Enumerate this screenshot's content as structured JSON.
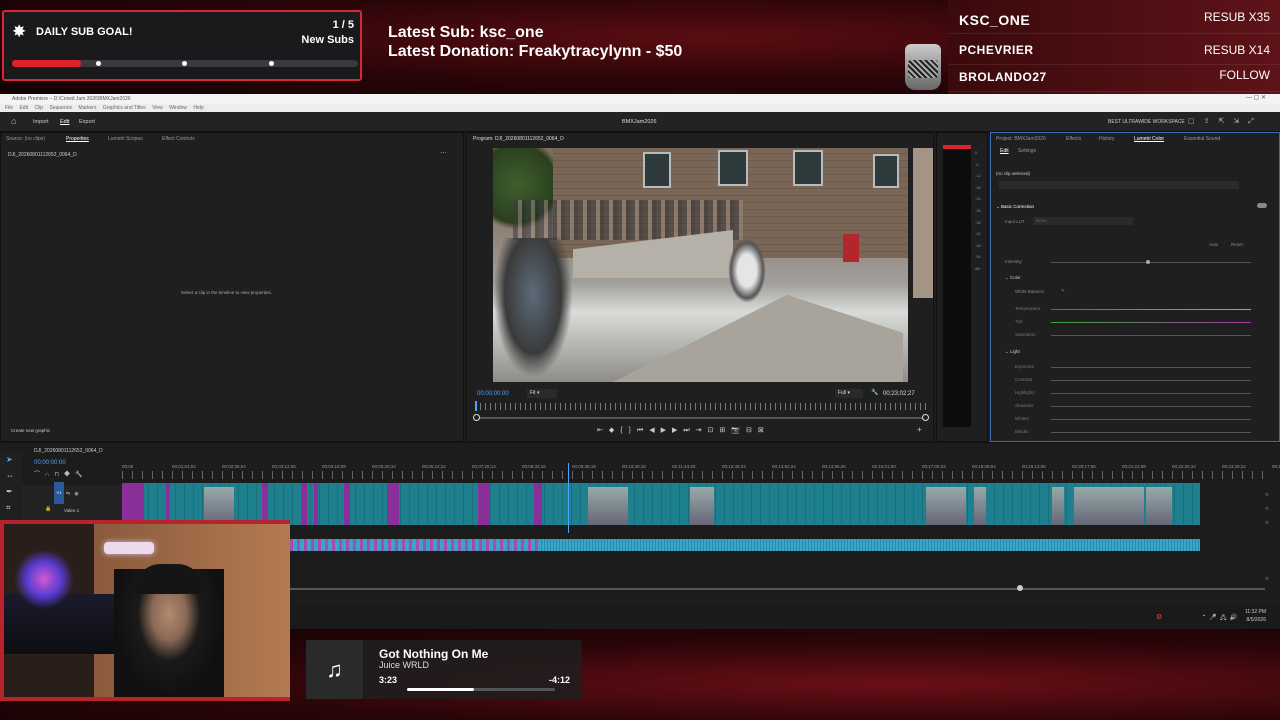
{
  "sub_goal": {
    "title": "DAILY SUB GOAL!",
    "count": "1 / 5",
    "unit": "New Subs",
    "progress": 0.2
  },
  "latest": {
    "sub": "Latest Sub: ksc_one",
    "donation": "Latest Donation: Freakytracylynn  - $50"
  },
  "subscribers": [
    {
      "name": "KSC_ONE",
      "tag": "RESUB X35"
    },
    {
      "name": "PCHEVRIER",
      "tag": "RESUB X14"
    },
    {
      "name": "BROLANDO27",
      "tag": "FOLLOW"
    }
  ],
  "premiere": {
    "window_title": "Adobe Premiere – D:\\Crowd Jam 2026\\BMXJam2026",
    "menu": [
      "File",
      "Edit",
      "Clip",
      "Sequence",
      "Markers",
      "Graphics and Titles",
      "View",
      "Window",
      "Help"
    ],
    "toolbar": {
      "import": "Import",
      "edit": "Edit",
      "export": "Export",
      "project": "BMXJam2026",
      "workspace": "BEST ULTRAWIDE WORKSPACE"
    },
    "source_tabs": [
      "Source: (no clips)",
      "Properties",
      "Lumetri Scopes",
      "Effect Controls"
    ],
    "source_clip": "DJI_20260801112652_0064_D",
    "source_empty": "Select a clip in the timeline to view properties.",
    "source_create": "Create new graphic",
    "program_title": "Program: DJI_20260801112652_0064_D",
    "program_tc_left": "00;00;00;00",
    "program_fit": "Fit",
    "program_full": "Full",
    "program_tc_right": "00;23;02;27",
    "meter_scale": [
      "0",
      "-6",
      "-12",
      "-18",
      "-24",
      "-30",
      "-36",
      "-42",
      "-48",
      "-54",
      "dB"
    ],
    "lumetri": {
      "tabs": [
        "Project: BMXJam2026",
        "Effects",
        "History",
        "Lumetri Color",
        "Essential Sound"
      ],
      "subtabs": [
        "Edit",
        "Settings"
      ],
      "no_clip": "(no clip selected)",
      "basic": "Basic Correction",
      "input_lut": "Input LUT",
      "lut_value": "None",
      "auto": "Auto",
      "reset": "Reset",
      "intensity": "Intensity",
      "color": "Color",
      "white_balance": "White Balance",
      "sliders_color": [
        "Temperature",
        "Tint",
        "Saturation"
      ],
      "light": "Light",
      "sliders_light": [
        "Exposure",
        "Contrast",
        "Highlights",
        "Shadows",
        "Whites",
        "Blacks"
      ]
    },
    "timeline": {
      "sequence": "DJI_20260801112652_0064_D",
      "timecode": "00;00;00;00",
      "ruler": [
        "00;00",
        "00;01;04;02",
        "00;02;08;04",
        "00;03;12;06",
        "00;04;16;08",
        "00;05;20;10",
        "00;06;24;12",
        "00;07;28;14",
        "00;08;32;16",
        "00;09;36;18",
        "00;10;40;18",
        "00;11;44;20",
        "00;12;48;22",
        "00;13;52;24",
        "00;14;56;26",
        "00;16;01;00",
        "00;17;05;02",
        "00;18;09;04",
        "00;19;13;06",
        "00;20;17;06",
        "00;21;21;08",
        "00;22;25;10",
        "00;23;29;12",
        "00;1"
      ],
      "track_v1": "Video 1",
      "track_badge": "V1"
    },
    "clock": {
      "time": "11:32 PM",
      "date": "8/5/2026"
    }
  },
  "music": {
    "song": "Got Nothing On Me",
    "artist": "Juice WRLD",
    "elapsed": "3:23",
    "remaining": "-4:12",
    "progress": 0.45
  },
  "colors": {
    "accent_red": "#d42a35",
    "timeline_blue": "#4aa3ff",
    "clip_teal": "#1e7f8e",
    "clip_magenta": "#8b2f9b"
  }
}
